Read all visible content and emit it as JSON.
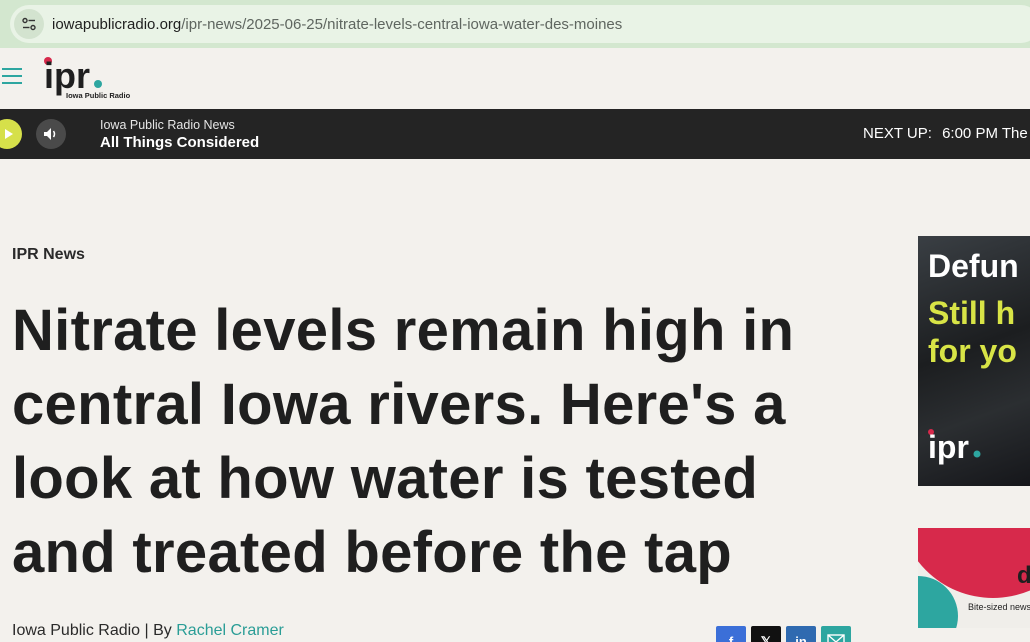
{
  "browser": {
    "url_host": "iowapublicradio.org",
    "url_path": "/ipr-news/2025-06-25/nitrate-levels-central-iowa-water-des-moines"
  },
  "header": {
    "logo_text": "ipr.",
    "logo_subtitle": "Iowa Public Radio"
  },
  "player": {
    "station": "Iowa Public Radio News",
    "program": "All Things Considered",
    "next_up_label": "NEXT UP:",
    "next_up_time": "6:00 PM",
    "next_up_program": "The D"
  },
  "article": {
    "kicker": "IPR News",
    "headline": "Nitrate levels remain high in central Iowa rivers. Here's a look at how water is tested and treated before the tap",
    "byline_source": "Iowa Public Radio",
    "byline_separator": " | By ",
    "author": "Rachel Cramer"
  },
  "share": {
    "facebook": "f",
    "x": "𝕏",
    "linkedin": "in"
  },
  "ads": {
    "ad1_line1": "Defun",
    "ad1_line2": "Still h",
    "ad1_line3": "for yo",
    "ad1_logo": "ipr.",
    "ad2_letter": "d",
    "ad2_caption": "Bite-sized news f"
  },
  "colors": {
    "brand_teal": "#2da6a0",
    "brand_red": "#d7294b",
    "accent_yellow": "#d6e04a",
    "player_bg": "#242424"
  }
}
